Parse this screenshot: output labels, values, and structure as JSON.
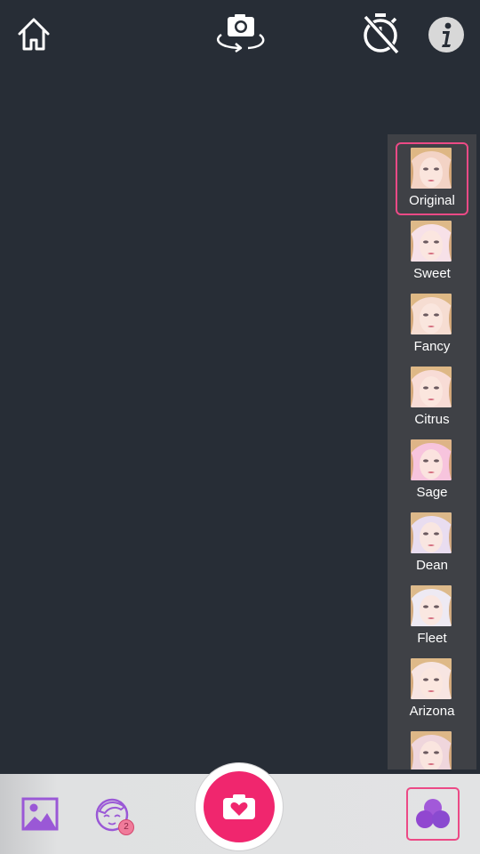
{
  "toolbar": {
    "home_icon": "home-icon",
    "flip_icon": "camera-switch-icon",
    "timer_icon": "timer-off-icon",
    "info_icon": "info-icon"
  },
  "filters": {
    "selected": "Original",
    "items": [
      {
        "label": "Original",
        "tint": "#f3d3c5"
      },
      {
        "label": "Sweet",
        "tint": "#f7e1e8"
      },
      {
        "label": "Fancy",
        "tint": "#f6ddd2"
      },
      {
        "label": "Citrus",
        "tint": "#f8dcd6"
      },
      {
        "label": "Sage",
        "tint": "#f7c4dd"
      },
      {
        "label": "Dean",
        "tint": "#e9ddf0"
      },
      {
        "label": "Fleet",
        "tint": "#eeeaf3"
      },
      {
        "label": "Arizona",
        "tint": "#f7e5e2"
      },
      {
        "label": "",
        "tint": "#efd6dc"
      }
    ]
  },
  "bottom": {
    "badge_count": "2",
    "accent": "#f0266e",
    "purple": "#9a58d6"
  }
}
